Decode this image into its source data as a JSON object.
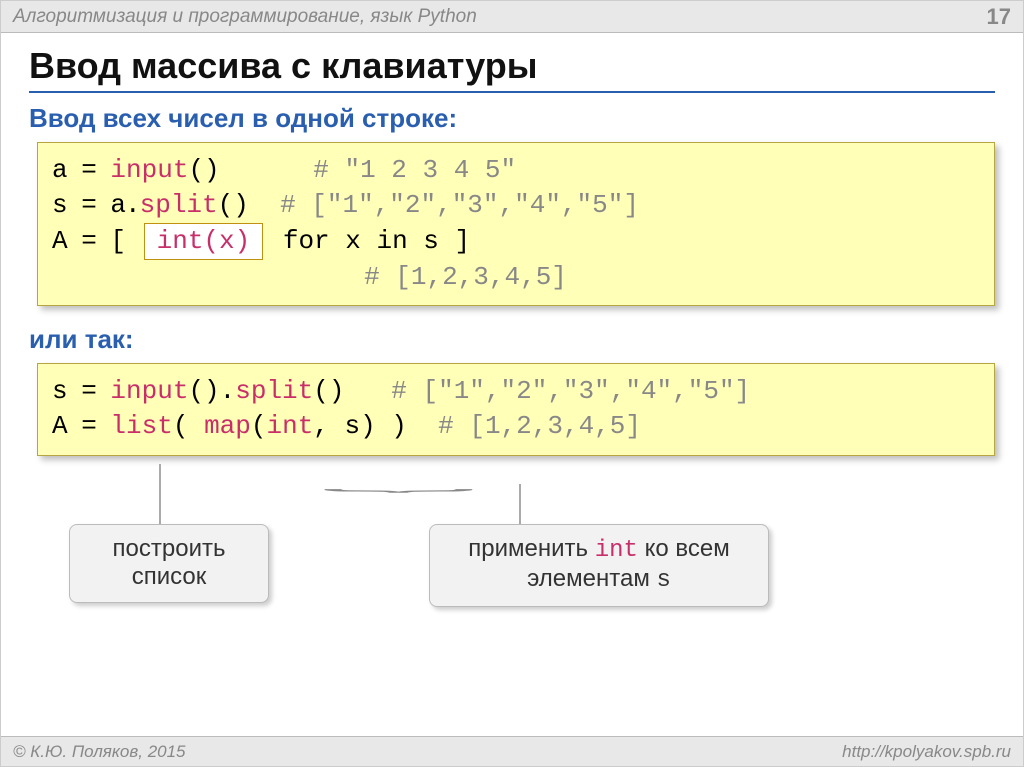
{
  "header": {
    "course": "Алгоритмизация и программирование, язык Python",
    "page": "17"
  },
  "title": "Ввод массива с клавиатуры",
  "subtitle": "Ввод всех чисел в одной строке:",
  "code1": {
    "l1a": "a = ",
    "l1b": "input",
    "l1c": "()",
    "l1comment": "# \"1 2 3 4 5\"",
    "l2a": "s = a.",
    "l2b": "split",
    "l2c": "()",
    "l2comment": "# [\"1\",\"2\",\"3\",\"4\",\"5\"]",
    "l3a": "A = [ ",
    "l3box": "int(x)",
    "l3b": " for x in s ]",
    "l4comment": "# [1,2,3,4,5]"
  },
  "or_text": "или так:",
  "code2": {
    "l1a": "s = ",
    "l1b": "input",
    "l1c": "().",
    "l1d": "split",
    "l1e": "()",
    "l1comment": "# [\"1\",\"2\",\"3\",\"4\",\"5\"]",
    "l2a": "A = ",
    "l2b": "list",
    "l2c": "( ",
    "l2d": "map",
    "l2e": "(",
    "l2f": "int",
    "l2g": ", s) )",
    "l2comment": "# [1,2,3,4,5]"
  },
  "callouts": {
    "c1": "построить список",
    "c2a": "применить ",
    "c2b": "int",
    "c2c": " ко всем элементам ",
    "c2d": "s"
  },
  "footer": {
    "left": "© К.Ю. Поляков, 2015",
    "right": "http://kpolyakov.spb.ru"
  }
}
